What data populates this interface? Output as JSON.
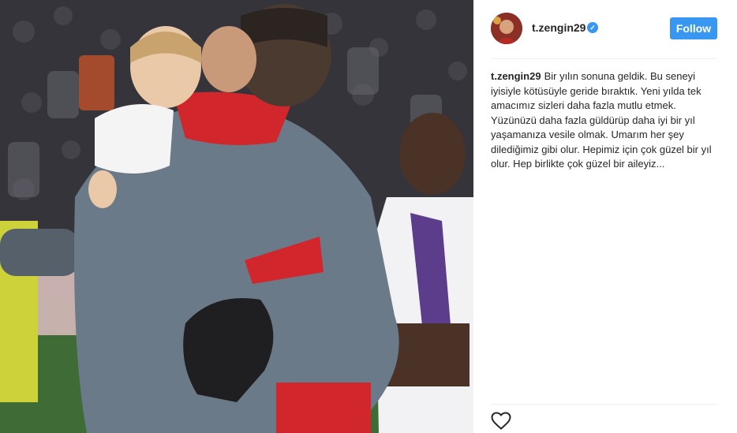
{
  "post": {
    "image_alt": "Goalkeeper hugging a teammate holding a child on the pitch",
    "author": {
      "username": "t.zengin29",
      "verified": true,
      "verified_icon": "verified-badge-icon",
      "verified_glyph": "✓"
    },
    "follow_button_label": "Follow",
    "caption": {
      "username": "t.zengin29",
      "text": "Bir yılın sonuna geldik. Bu seneyi iyisiyle kötüsüyle geride bıraktık. Yeni yılda tek amacımız sizleri daha fazla mutlu etmek. Yüzünüzü daha fazla güldürüp daha iyi bir yıl yaşamanıza vesile olmak. Umarım her şey dilediğimiz gibi olur. Hepimiz için çok güzel bir yıl olur. Hep birlikte çok güzel bir aileyiz..."
    },
    "actions": {
      "like_icon": "heart-outline-icon"
    },
    "colors": {
      "accent": "#3897f0",
      "text": "#262626",
      "divider": "#efefef"
    }
  }
}
